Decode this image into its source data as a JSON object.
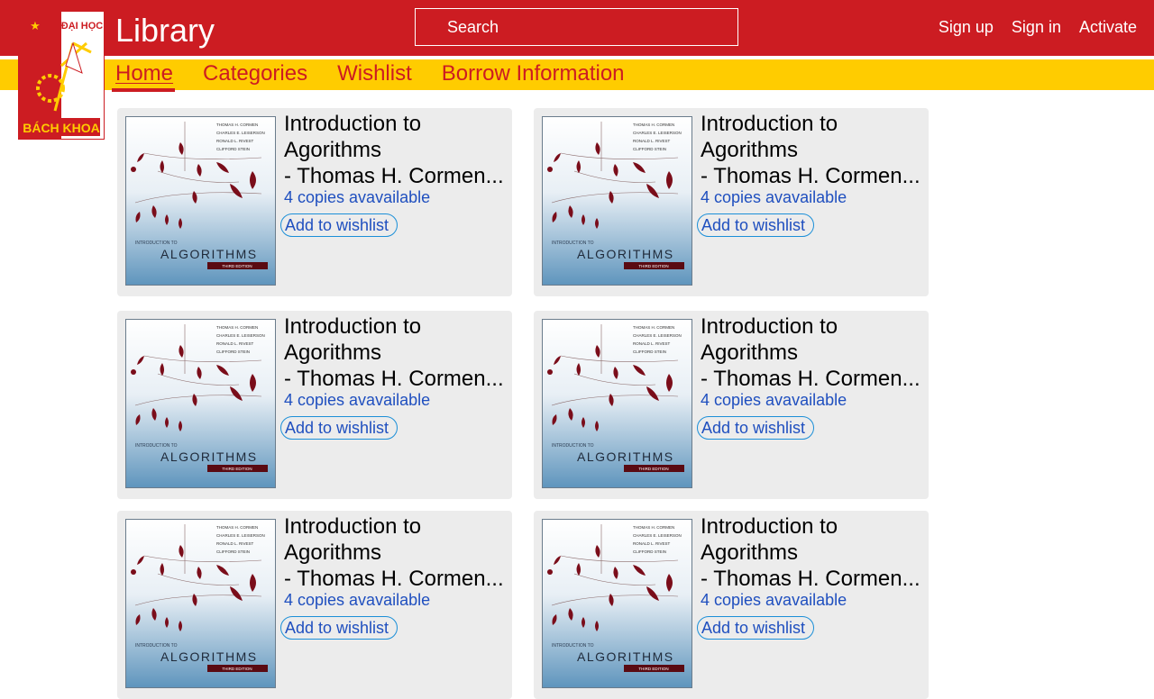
{
  "header": {
    "logo": {
      "line1": "ĐẠI HỌC",
      "line2": "BÁCH KHOA",
      "star": "★"
    },
    "app_title": "Library",
    "search": {
      "placeholder": "Search",
      "value": ""
    },
    "links": [
      {
        "label": "Sign up"
      },
      {
        "label": "Sign in"
      },
      {
        "label": "Activate"
      }
    ],
    "colors": {
      "primary": "#cc1c22",
      "nav_bg": "#ffcc00"
    }
  },
  "nav": {
    "items": [
      {
        "label": "Home",
        "active": true
      },
      {
        "label": "Categories",
        "active": false
      },
      {
        "label": "Wishlist",
        "active": false
      },
      {
        "label": "Borrow Information",
        "active": false
      }
    ]
  },
  "books": [
    {
      "title": "Introduction to\nAgorithms\n- Thomas H. Cormen...",
      "copies": "4 copies avavailable",
      "wishlist_label": "Add to wishlist",
      "cover": {
        "authors": [
          "THOMAS H. CORMEN",
          "CHARLES E. LEISERSON",
          "RONALD L. RIVEST",
          "CLIFFORD STEIN"
        ],
        "intro": "INTRODUCTION TO",
        "title": "ALGORITHMS",
        "edition": "THIRD EDITION"
      }
    },
    {
      "title": "Introduction to\nAgorithms\n- Thomas H. Cormen...",
      "copies": "4 copies avavailable",
      "wishlist_label": "Add to wishlist",
      "cover": {
        "authors": [
          "THOMAS H. CORMEN",
          "CHARLES E. LEISERSON",
          "RONALD L. RIVEST",
          "CLIFFORD STEIN"
        ],
        "intro": "INTRODUCTION TO",
        "title": "ALGORITHMS",
        "edition": "THIRD EDITION"
      }
    },
    {
      "title": "Introduction to\nAgorithms\n- Thomas H. Cormen...",
      "copies": "4 copies avavailable",
      "wishlist_label": "Add to wishlist",
      "cover": {
        "authors": [
          "THOMAS H. CORMEN",
          "CHARLES E. LEISERSON",
          "RONALD L. RIVEST",
          "CLIFFORD STEIN"
        ],
        "intro": "INTRODUCTION TO",
        "title": "ALGORITHMS",
        "edition": "THIRD EDITION"
      }
    },
    {
      "title": "Introduction to\nAgorithms\n- Thomas H. Cormen...",
      "copies": "4 copies avavailable",
      "wishlist_label": "Add to wishlist",
      "cover": {
        "authors": [
          "THOMAS H. CORMEN",
          "CHARLES E. LEISERSON",
          "RONALD L. RIVEST",
          "CLIFFORD STEIN"
        ],
        "intro": "INTRODUCTION TO",
        "title": "ALGORITHMS",
        "edition": "THIRD EDITION"
      }
    },
    {
      "title": "Introduction to\nAgorithms\n- Thomas H. Cormen...",
      "copies": "4 copies avavailable",
      "wishlist_label": "Add to wishlist",
      "cover": {
        "authors": [
          "THOMAS H. CORMEN",
          "CHARLES E. LEISERSON",
          "RONALD L. RIVEST",
          "CLIFFORD STEIN"
        ],
        "intro": "INTRODUCTION TO",
        "title": "ALGORITHMS",
        "edition": "THIRD EDITION"
      }
    },
    {
      "title": "Introduction to\nAgorithms\n- Thomas H. Cormen...",
      "copies": "4 copies avavailable",
      "wishlist_label": "Add to wishlist",
      "cover": {
        "authors": [
          "THOMAS H. CORMEN",
          "CHARLES E. LEISERSON",
          "RONALD L. RIVEST",
          "CLIFFORD STEIN"
        ],
        "intro": "INTRODUCTION TO",
        "title": "ALGORITHMS",
        "edition": "THIRD EDITION"
      }
    }
  ]
}
